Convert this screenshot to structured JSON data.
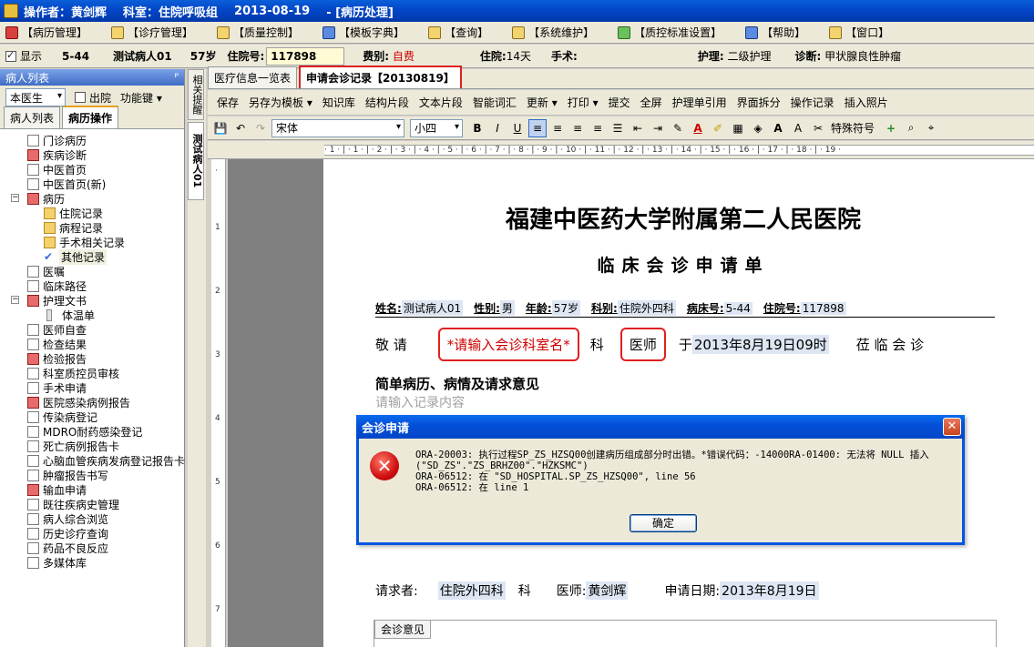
{
  "titlebar": {
    "operator": "操作者：黄剑辉",
    "department": "科室：住院呼吸组",
    "date": "2013-08-19",
    "mode": "- [病历处理]"
  },
  "menu": [
    {
      "label": "【病历管理】"
    },
    {
      "label": "【诊疗管理】"
    },
    {
      "label": "【质量控制】"
    },
    {
      "label": "【模板字典】"
    },
    {
      "label": "【查询】"
    },
    {
      "label": "【系统维护】"
    },
    {
      "label": "【质控标准设置】"
    },
    {
      "label": "【帮助】"
    },
    {
      "label": "【窗口】"
    }
  ],
  "infobar": {
    "show_label": "显示",
    "bed": "5-44",
    "patient_name": "测试病人01",
    "age": "57岁",
    "inpatient_no_label": "住院号:",
    "inpatient_no": "117898",
    "fee_label": "费别:",
    "fee_value": "自费",
    "stay_label": "住院:",
    "stay_value": "14天",
    "surgery_label": "手术:",
    "nursing_label": "护理:",
    "nursing_value": "二级护理",
    "diagnosis_label": "诊断:",
    "diagnosis_value": "甲状腺良性肿瘤"
  },
  "leftpanel": {
    "title": "病人列表",
    "pin": "ᴾ",
    "doctor_select": "本医生",
    "discharged_label": "出院",
    "function_key": "功能键",
    "tabs": [
      "病人列表",
      "病历操作"
    ],
    "tree": [
      {
        "label": "门诊病历",
        "level": 1,
        "icon": "doc"
      },
      {
        "label": "疾病诊断",
        "level": 1,
        "icon": "red"
      },
      {
        "label": "中医首页",
        "level": 1,
        "icon": "doc"
      },
      {
        "label": "中医首页(新)",
        "level": 1,
        "icon": "doc"
      },
      {
        "label": "病历",
        "level": 1,
        "icon": "red",
        "expander": "−"
      },
      {
        "label": "住院记录",
        "level": 2,
        "icon": "folder"
      },
      {
        "label": "病程记录",
        "level": 2,
        "icon": "folder"
      },
      {
        "label": "手术相关记录",
        "level": 2,
        "icon": "folder"
      },
      {
        "label": "其他记录",
        "level": 2,
        "icon": "check",
        "selected": true
      },
      {
        "label": "医嘱",
        "level": 1,
        "icon": "doc"
      },
      {
        "label": "临床路径",
        "level": 1,
        "icon": "doc"
      },
      {
        "label": "护理文书",
        "level": 1,
        "icon": "red",
        "expander": "−"
      },
      {
        "label": "体温单",
        "level": 2,
        "icon": "thermo"
      },
      {
        "label": "医师自查",
        "level": 1,
        "icon": "doc"
      },
      {
        "label": "检查结果",
        "level": 1,
        "icon": "doc"
      },
      {
        "label": "检验报告",
        "level": 1,
        "icon": "red"
      },
      {
        "label": "科室质控员审核",
        "level": 1,
        "icon": "doc"
      },
      {
        "label": "手术申请",
        "level": 1,
        "icon": "doc"
      },
      {
        "label": "医院感染病例报告",
        "level": 1,
        "icon": "red"
      },
      {
        "label": "传染病登记",
        "level": 1,
        "icon": "doc"
      },
      {
        "label": "MDRO耐药感染登记",
        "level": 1,
        "icon": "doc"
      },
      {
        "label": "死亡病例报告卡",
        "level": 1,
        "icon": "doc"
      },
      {
        "label": "心脑血管疾病发病登记报告卡",
        "level": 1,
        "icon": "doc"
      },
      {
        "label": "肿瘤报告书写",
        "level": 1,
        "icon": "doc"
      },
      {
        "label": "输血申请",
        "level": 1,
        "icon": "red"
      },
      {
        "label": "既往疾病史管理",
        "level": 1,
        "icon": "doc"
      },
      {
        "label": "病人综合浏览",
        "level": 1,
        "icon": "doc"
      },
      {
        "label": "历史诊疗查询",
        "level": 1,
        "icon": "doc"
      },
      {
        "label": "药品不良反应",
        "level": 1,
        "icon": "doc"
      },
      {
        "label": "多媒体库",
        "level": 1,
        "icon": "doc"
      }
    ]
  },
  "vtabs": [
    "相关提醒",
    "测试病人01"
  ],
  "doctabs": [
    "医疗信息一览表",
    "申请会诊记录【20130819】"
  ],
  "toolbar1": [
    "保存",
    "另存为模板 ▾",
    "知识库",
    "结构片段",
    "文本片段",
    "智能词汇",
    "更新 ▾",
    "打印 ▾",
    "提交",
    "全屏",
    "护理单引用",
    "界面拆分",
    "操作记录",
    "插入照片"
  ],
  "toolbar2": {
    "font": "宋体",
    "size": "小四",
    "special_symbol": "特殊符号"
  },
  "ruler_text": "· 1 · | · 1 · | · 2 · | · 3 · | · 4 · | · 5 · | · 6 · | · 7 · | · 8 · | · 9 · | · 10 · | · 11 · | · 12 · | · 13 · | · 14 · | · 15 · | · 16 · | · 17 · | · 18 · | · 19 ·",
  "document": {
    "hospital": "福建中医药大学附属第二人民医院",
    "form_title": "临床会诊申请单",
    "patient_row": [
      {
        "label": "姓名:",
        "value": "测试病人01"
      },
      {
        "label": "性别:",
        "value": "男"
      },
      {
        "label": "年龄:",
        "value": "57岁"
      },
      {
        "label": "科别:",
        "value": "住院外四科"
      },
      {
        "label": "病床号:",
        "value": "5-44"
      },
      {
        "label": "住院号:",
        "value": "117898"
      }
    ],
    "invite_prefix": "敬  请",
    "invite_dept_placeholder": "*请输入会诊科室名*",
    "invite_dept_suffix": "科",
    "invite_doctor": "医师",
    "invite_time_prefix": "于",
    "invite_time": "2013年8月19日09时",
    "invite_suffix": "莅 临 会 诊",
    "section_title": "简单病历、病情及请求意见",
    "placeholder": "请输入记录内容",
    "requester_label": "请求者:",
    "requester_dept": "住院外四科",
    "requester_dept_suffix": "科",
    "doctor_label": "医师:",
    "doctor_name": "黄剑辉",
    "apply_date_label": "申请日期:",
    "apply_date": "2013年8月19日",
    "opinion_tab": "会诊意见"
  },
  "dialog": {
    "title": "会诊申请",
    "close": "✕",
    "message": "ORA-20003: 执行过程SP_ZS_HZSQ00创建病历组成部分时出错。*错误代码：-14000RA-01400: 无法将 NULL 插入\n(\"SD_ZS\".\"ZS_BRHZ00\".\"HZKSMC\")\nORA-06512: 在 \"SD_HOSPITAL.SP_ZS_HZSQ00\", line 56\nORA-06512: 在 line 1",
    "ok_label": "确定"
  }
}
